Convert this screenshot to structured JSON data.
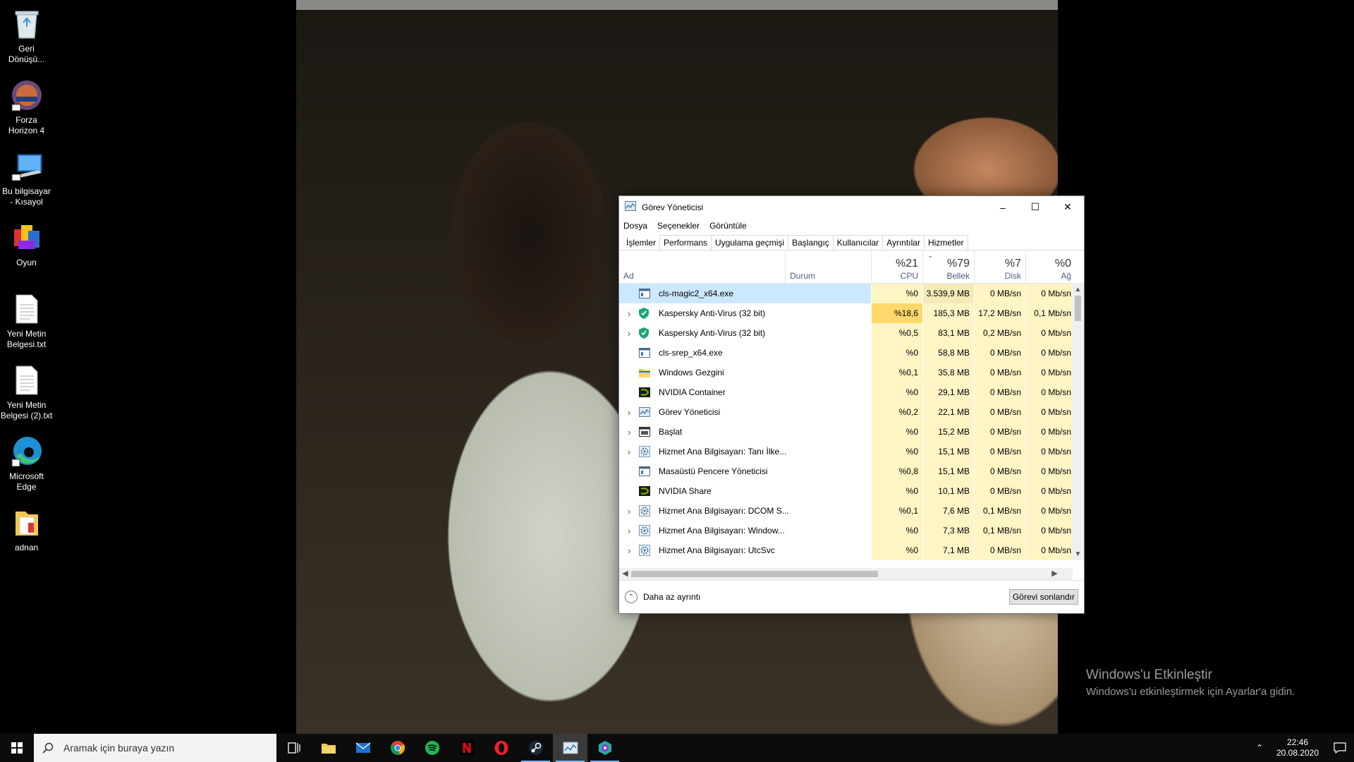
{
  "desktop": {
    "icons": [
      {
        "label": "Geri Dönüşü...",
        "icon": "recycle-bin-icon"
      },
      {
        "label": "Forza Horizon 4",
        "icon": "forza-horizon-icon"
      },
      {
        "label": "Bu bilgisayar - Kısayol",
        "icon": "this-pc-icon"
      },
      {
        "label": "Oyun",
        "icon": "game-box-icon"
      },
      {
        "label": "Yeni Metin Belgesi.txt",
        "icon": "text-file-icon"
      },
      {
        "label": "Yeni Metin Belgesi (2).txt",
        "icon": "text-file-icon"
      },
      {
        "label": "Microsoft Edge",
        "icon": "edge-icon"
      },
      {
        "label": "adnan",
        "icon": "folder-icon"
      }
    ]
  },
  "taskmanager": {
    "title": "Görev Yöneticisi",
    "menu": [
      "Dosya",
      "Seçenekler",
      "Görüntüle"
    ],
    "tabs": [
      "İşlemler",
      "Performans",
      "Uygulama geçmişi",
      "Başlangıç",
      "Kullanıcılar",
      "Ayrıntılar",
      "Hizmetler"
    ],
    "active_tab": "İşlemler",
    "header": {
      "name": "Ad",
      "status": "Durum",
      "cpu_pct": "%21",
      "cpu": "CPU",
      "mem_pct": "%79",
      "mem": "Bellek",
      "disk_pct": "%7",
      "disk": "Disk",
      "net_pct": "%0",
      "net": "Ağ"
    },
    "rows": [
      {
        "name": "cls-magic2_x64.exe",
        "expand": false,
        "cpu": "%0",
        "mem": "3.539,9 MB",
        "disk": "0 MB/sn",
        "net": "0 Mb/sn",
        "icon": "app-window-icon",
        "selected": true
      },
      {
        "name": "Kaspersky Anti-Virus (32 bit)",
        "expand": true,
        "cpu": "%18,6",
        "mem": "185,3 MB",
        "disk": "17,2 MB/sn",
        "net": "0,1 Mb/sn",
        "icon": "kaspersky-shield-icon"
      },
      {
        "name": "Kaspersky Anti-Virus (32 bit)",
        "expand": true,
        "cpu": "%0,5",
        "mem": "83,1 MB",
        "disk": "0,2 MB/sn",
        "net": "0 Mb/sn",
        "icon": "kaspersky-shield-icon"
      },
      {
        "name": "cls-srep_x64.exe",
        "expand": false,
        "cpu": "%0",
        "mem": "58,8 MB",
        "disk": "0 MB/sn",
        "net": "0 Mb/sn",
        "icon": "app-window-icon"
      },
      {
        "name": "Windows Gezgini",
        "expand": false,
        "cpu": "%0,1",
        "mem": "35,8 MB",
        "disk": "0 MB/sn",
        "net": "0 Mb/sn",
        "icon": "explorer-folder-icon"
      },
      {
        "name": "NVIDIA Container",
        "expand": false,
        "cpu": "%0",
        "mem": "29,1 MB",
        "disk": "0 MB/sn",
        "net": "0 Mb/sn",
        "icon": "nvidia-icon"
      },
      {
        "name": "Görev Yöneticisi",
        "expand": true,
        "cpu": "%0,2",
        "mem": "22,1 MB",
        "disk": "0 MB/sn",
        "net": "0 Mb/sn",
        "icon": "task-manager-icon"
      },
      {
        "name": "Başlat",
        "expand": true,
        "cpu": "%0",
        "mem": "15,2 MB",
        "disk": "0 MB/sn",
        "net": "0 Mb/sn",
        "icon": "start-window-icon"
      },
      {
        "name": "Hizmet Ana Bilgisayarı: Tanı İlke...",
        "expand": true,
        "cpu": "%0",
        "mem": "15,1 MB",
        "disk": "0 MB/sn",
        "net": "0 Mb/sn",
        "icon": "service-gear-icon"
      },
      {
        "name": "Masaüstü Pencere Yöneticisi",
        "expand": false,
        "cpu": "%0,8",
        "mem": "15,1 MB",
        "disk": "0 MB/sn",
        "net": "0 Mb/sn",
        "icon": "app-window-icon"
      },
      {
        "name": "NVIDIA Share",
        "expand": false,
        "cpu": "%0",
        "mem": "10,1 MB",
        "disk": "0 MB/sn",
        "net": "0 Mb/sn",
        "icon": "nvidia-icon"
      },
      {
        "name": "Hizmet Ana Bilgisayarı: DCOM S...",
        "expand": true,
        "cpu": "%0,1",
        "mem": "7,6 MB",
        "disk": "0,1 MB/sn",
        "net": "0 Mb/sn",
        "icon": "service-gear-icon"
      },
      {
        "name": "Hizmet Ana Bilgisayarı: Window...",
        "expand": true,
        "cpu": "%0",
        "mem": "7,3 MB",
        "disk": "0,1 MB/sn",
        "net": "0 Mb/sn",
        "icon": "service-gear-icon"
      },
      {
        "name": "Hizmet Ana Bilgisayarı: UtcSvc",
        "expand": true,
        "cpu": "%0",
        "mem": "7,1 MB",
        "disk": "0 MB/sn",
        "net": "0 Mb/sn",
        "icon": "service-gear-icon"
      }
    ],
    "footer": {
      "less_details": "Daha az ayrıntı",
      "end_task": "Görevi sonlandır"
    },
    "colors": {
      "selected": "#cce8ff",
      "cpu_high": "#ffd86b",
      "cell_light": "#fff4c4",
      "mem_high": "#f5e9b8"
    }
  },
  "activation": {
    "title": "Windows'u Etkinleştir",
    "subtitle": "Windows'u etkinleştirmek için Ayarlar'a gidin."
  },
  "taskbar": {
    "search_placeholder": "Aramak için buraya yazın",
    "apps": [
      "task-view-icon",
      "file-explorer-icon",
      "mail-icon",
      "chrome-icon",
      "spotify-icon",
      "netflix-icon",
      "opera-icon",
      "steam-icon",
      "task-manager-icon",
      "proton-vpn-icon"
    ],
    "time": "22:46",
    "date": "20.08.2020"
  }
}
